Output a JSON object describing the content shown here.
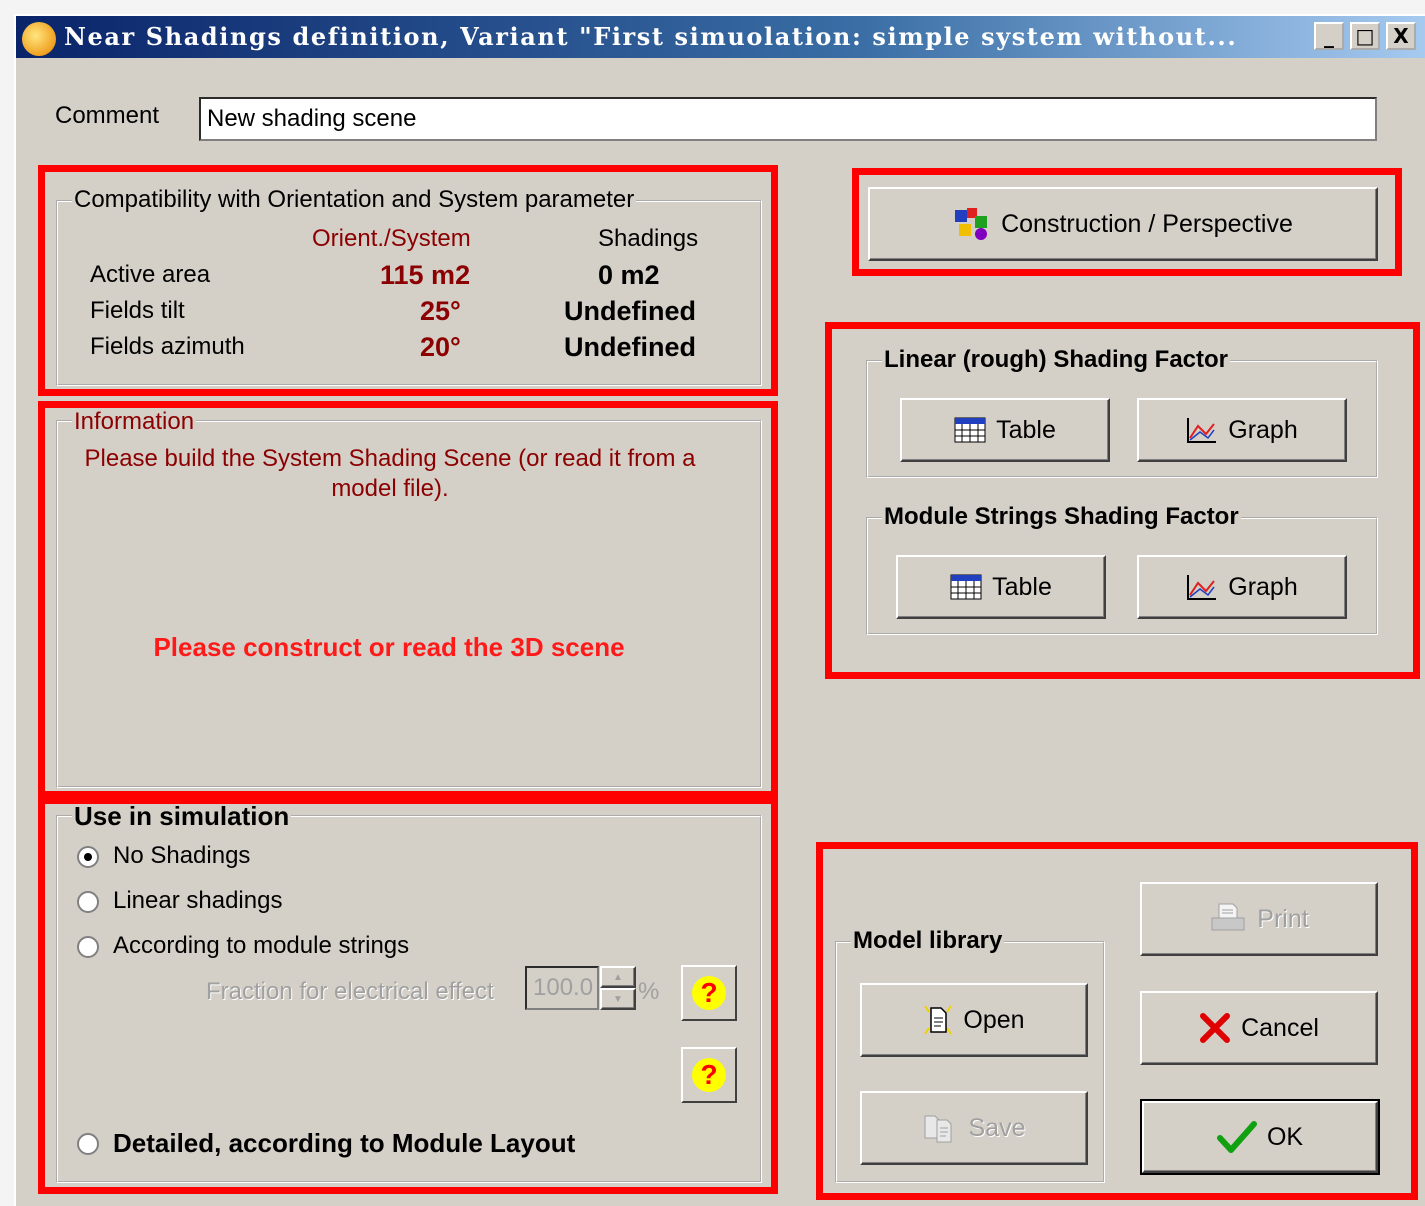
{
  "window": {
    "title": "Near Shadings definition, Variant \"First simuolation: simple system without...",
    "controls": [
      "_",
      "□",
      "X"
    ]
  },
  "comment": {
    "label": "Comment",
    "value": "New shading scene"
  },
  "compat": {
    "legend": "Compatibility with Orientation and System parameter",
    "col_orient": "Orient./System",
    "col_shadings": "Shadings",
    "rows": [
      {
        "label": "Active area",
        "orient": "115 m2",
        "shadings": "0 m2"
      },
      {
        "label": "Fields tilt",
        "orient": "25°",
        "shadings": "Undefined"
      },
      {
        "label": "Fields azimuth",
        "orient": "20°",
        "shadings": "Undefined"
      }
    ]
  },
  "info": {
    "legend": "Information",
    "message": "Please build the System Shading Scene  (or read it from a model file).",
    "warning": "Please construct or read the 3D scene"
  },
  "simulation": {
    "legend": "Use in simulation",
    "options": [
      "No Shadings",
      "Linear shadings",
      "According to module strings",
      "Detailed, according to Module Layout"
    ],
    "selected": 0,
    "fraction_label": "Fraction for electrical effect",
    "fraction_value": "100.0",
    "fraction_unit": "%",
    "help_glyph": "?"
  },
  "construction": {
    "label": "Construction / Perspective",
    "icon": "scene-builder-icon"
  },
  "linear": {
    "legend": "Linear (rough)  Shading Factor",
    "table": "Table",
    "graph": "Graph"
  },
  "module": {
    "legend": "Module Strings Shading Factor",
    "table": "Table",
    "graph": "Graph"
  },
  "library": {
    "legend": "Model library",
    "open": "Open",
    "save": "Save"
  },
  "actions": {
    "print": "Print",
    "cancel": "Cancel",
    "ok": "OK"
  },
  "colors": {
    "highlight": "#ff0000",
    "dialog_bg": "#d4d0c8",
    "dark_red": "#8b0000"
  }
}
